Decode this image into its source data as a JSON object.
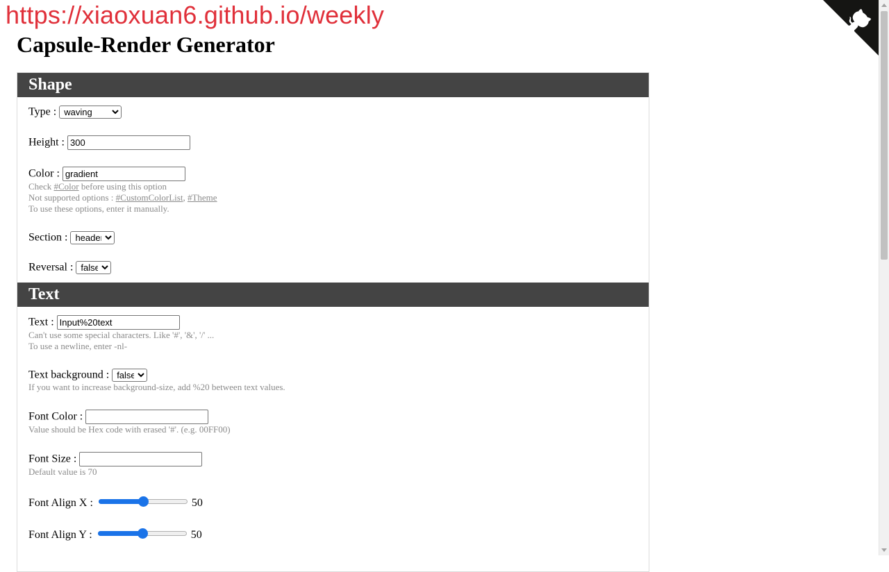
{
  "watermark": "https://xiaoxuan6.github.io/weekly",
  "page_title": "Capsule-Render Generator",
  "corner_icon": "github-octocat-icon",
  "sections": {
    "shape": {
      "title": "Shape",
      "type": {
        "label": "Type :",
        "value": "waving"
      },
      "height": {
        "label": "Height :",
        "value": "300"
      },
      "color": {
        "label": "Color :",
        "value": "gradient",
        "hint1_pre": "Check ",
        "hint1_link": "#Color",
        "hint1_post": " before using this option",
        "hint2_pre": "Not supported options : ",
        "hint2_link1": "#CustomColorList",
        "hint2_sep": ", ",
        "hint2_link2": "#Theme",
        "hint3": "To use these options, enter it manually."
      },
      "section": {
        "label": "Section :",
        "value": "header"
      },
      "reversal": {
        "label": "Reversal :",
        "value": "false"
      }
    },
    "text": {
      "title": "Text",
      "text": {
        "label": "Text :",
        "value": "Input%20text",
        "hint1": "Can't use some special characters. Like '#', '&', '/' ...",
        "hint2": "To use a newline, enter -nl-"
      },
      "background": {
        "label": "Text background :",
        "value": "false",
        "hint": "If you want to increase background-size, add %20 between text values."
      },
      "font_color": {
        "label": "Font Color :",
        "value": "",
        "hint": "Value should be Hex code with erased '#'. (e.g. 00FF00)"
      },
      "font_size": {
        "label": "Font Size :",
        "value": "",
        "hint": "Default value is 70"
      },
      "align_x": {
        "label": "Font Align X :",
        "value": "50",
        "level": 0.5
      },
      "align_y": {
        "label": "Font Align Y :",
        "value": "50",
        "level": 0.5
      }
    }
  }
}
